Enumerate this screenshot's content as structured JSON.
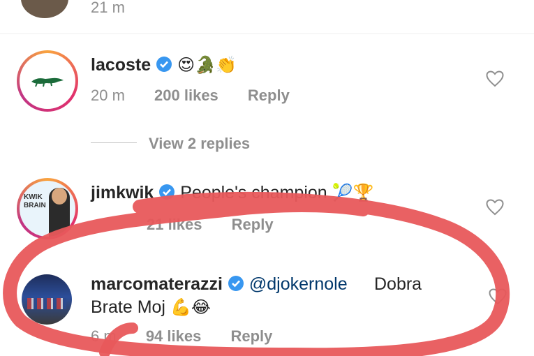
{
  "top_comment": {
    "time": "21 m"
  },
  "comments": [
    {
      "username": "lacoste",
      "text": "",
      "emojis": "😍🐊👏",
      "time": "20 m",
      "likes": "200 likes",
      "reply": "Reply",
      "avatar_icon": "lacoste-crocodile-logo"
    },
    {
      "username": "jimkwik",
      "text": "People's champion",
      "emojis": "🎾🏆",
      "time": "21 m",
      "likes": "21 likes",
      "reply": "Reply",
      "avatar_text": "KWIK BRAIN",
      "avatar_icon": "kwik-brain-logo"
    },
    {
      "username": "marcomaterazzi",
      "mention": "@djokernole",
      "text": "Dobra Brate Moj",
      "emojis": "💪😂",
      "time": "6 m",
      "likes": "94 likes",
      "reply": "Reply",
      "avatar_icon": "team-photo"
    }
  ],
  "view_replies": "View 2 replies",
  "colors": {
    "link": "#00376b",
    "muted": "#8e8e8e",
    "verified": "#3897f0",
    "annotation": "#e8585b"
  }
}
